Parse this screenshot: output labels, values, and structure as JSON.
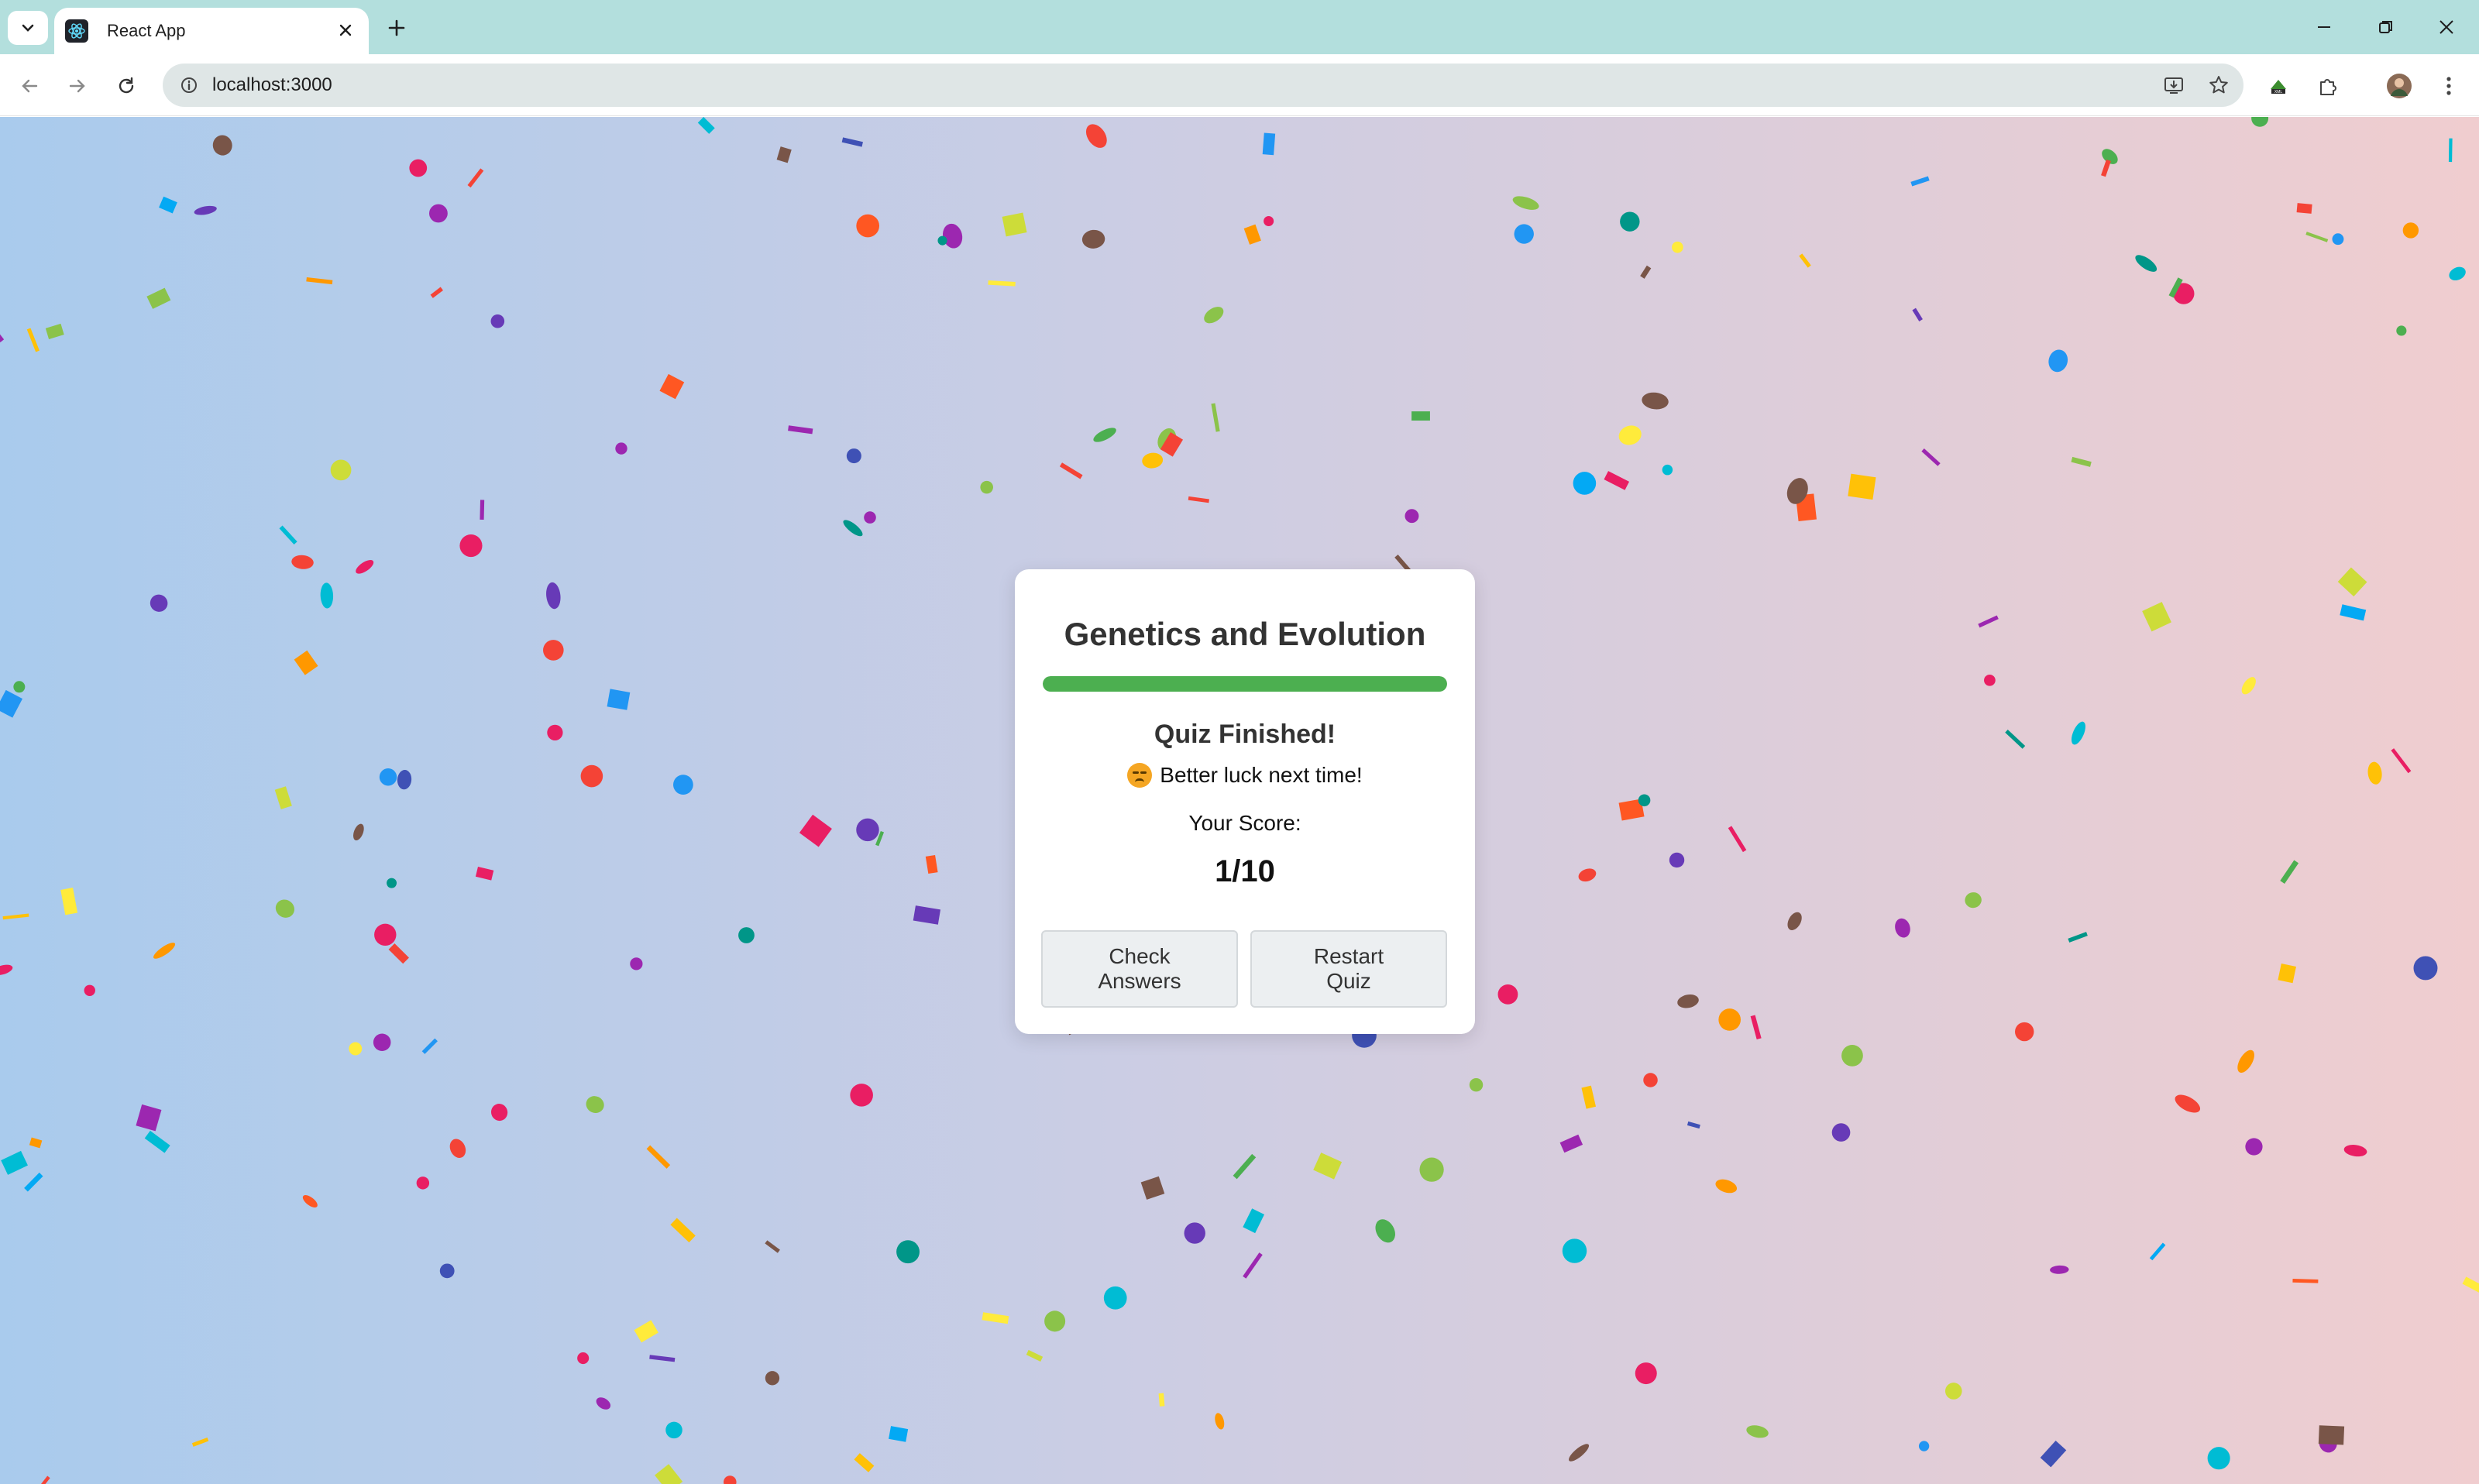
{
  "browser": {
    "tab_title": "React App",
    "url": "localhost:3000",
    "icons": [
      "tab-search-icon",
      "react-favicon-icon",
      "close-icon",
      "new-tab-icon",
      "minimize-icon",
      "restore-icon",
      "window-close-icon",
      "back-icon",
      "forward-icon",
      "reload-icon",
      "site-info-icon",
      "install-app-icon",
      "bookmark-star-icon",
      "extension-icon",
      "puzzle-icon",
      "avatar",
      "kebab-menu-icon"
    ]
  },
  "quiz": {
    "title": "Genetics and Evolution",
    "progress": 1.0,
    "finished_heading": "Quiz Finished!",
    "message": "Better luck next time!",
    "emoji": "disappointed-face",
    "score_label": "Your Score:",
    "score": "1/10",
    "check_answers_label": "Check Answers",
    "restart_label": "Restart Quiz"
  },
  "colors": {
    "progress_fill": "#4caf50",
    "gradient_left": "#a9cbed",
    "gradient_right": "#f0cdcf",
    "confetti": [
      "#f44336",
      "#e91e63",
      "#9c27b0",
      "#673ab7",
      "#3f51b5",
      "#2196f3",
      "#03a9f4",
      "#00bcd4",
      "#009688",
      "#4caf50",
      "#8bc34a",
      "#cddc39",
      "#ffeb3b",
      "#ffc107",
      "#ff9800",
      "#ff5722",
      "#795548"
    ]
  }
}
